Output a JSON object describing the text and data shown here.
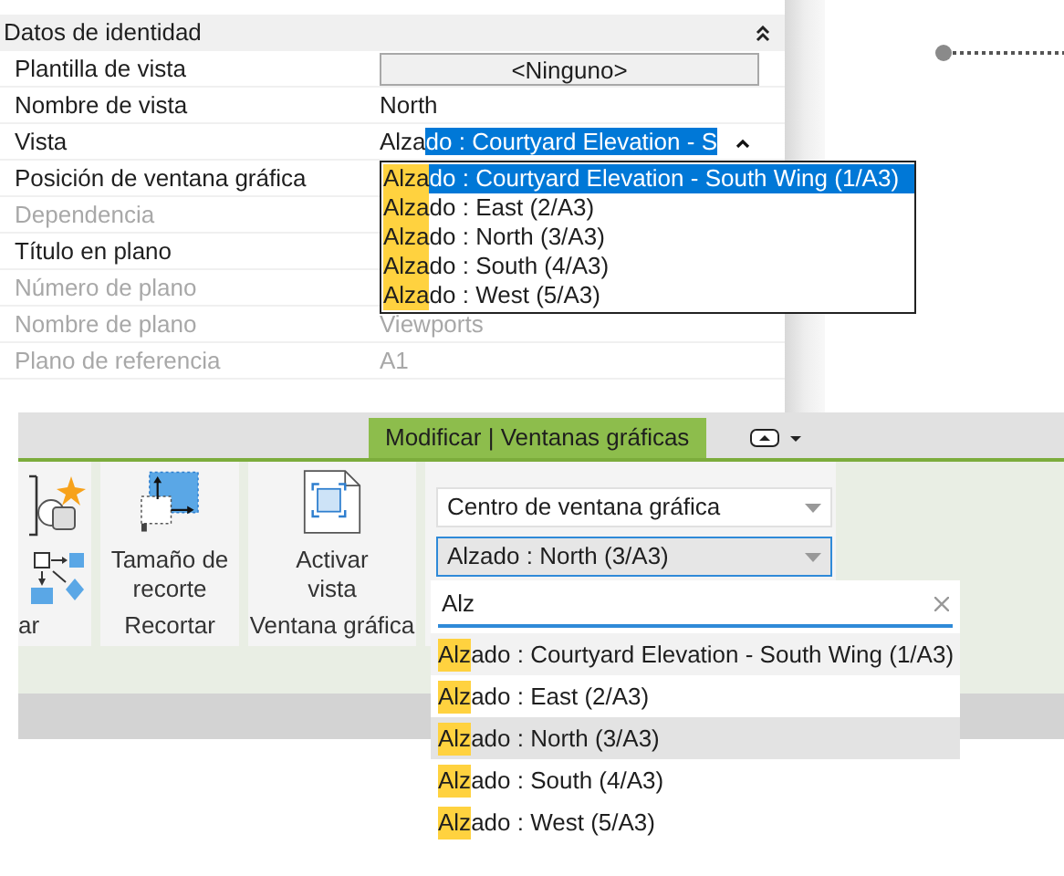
{
  "properties": {
    "section": {
      "title": "Datos de identidad",
      "expanded": true
    },
    "rows": [
      {
        "label": "Plantilla de vista",
        "kind": "button",
        "value": "<Ninguno>",
        "disabled": false
      },
      {
        "label": "Nombre de vista",
        "kind": "text",
        "value": "North",
        "disabled": false
      },
      {
        "label": "Vista",
        "kind": "combo",
        "typed": "Alza",
        "selected_text": "do : Courtyard Elevation - S",
        "disabled": false
      },
      {
        "label": "Posición de ventana gráfica",
        "kind": "text",
        "disabled": false
      },
      {
        "label": "Dependencia",
        "kind": "text",
        "disabled": true
      },
      {
        "label": "Título en plano",
        "kind": "text",
        "disabled": false
      },
      {
        "label": "Número de plano",
        "kind": "text",
        "disabled": true
      },
      {
        "label": "Nombre de plano",
        "kind": "text",
        "value": "Viewports",
        "disabled": true
      },
      {
        "label": "Plano de referencia",
        "kind": "text",
        "value": "A1",
        "disabled": true
      }
    ],
    "dropdown": [
      {
        "match": "Alza",
        "rest": "do : Courtyard Elevation - South Wing (1/A3)",
        "selected": true
      },
      {
        "match": "Alza",
        "rest": "do : East (2/A3)",
        "selected": false
      },
      {
        "match": "Alza",
        "rest": "do : North (3/A3)",
        "selected": false
      },
      {
        "match": "Alza",
        "rest": "do : South (4/A3)",
        "selected": false
      },
      {
        "match": "Alza",
        "rest": "do : West (5/A3)",
        "selected": false
      }
    ]
  },
  "ribbon": {
    "tabs": [
      {
        "label": "Modificar | Ventanas gráficas",
        "selected": true
      }
    ],
    "panels": [
      {
        "kind": "cut",
        "footer": "ar"
      },
      {
        "kind": "crop",
        "label": "Tamaño de recorte",
        "footer": "Recortar"
      },
      {
        "kind": "activate",
        "label": "Activar vista",
        "footer": "Ventana gráfica"
      },
      {
        "kind": "combos",
        "combos": [
          {
            "value": "Centro de ventana gráfica",
            "focused": false
          },
          {
            "value": "Alzado : North (3/A3)",
            "focused": true
          }
        ]
      }
    ],
    "search": {
      "value": "Alz"
    },
    "results": [
      {
        "match": "Alz",
        "rest": "ado : Courtyard Elevation - South Wing (1/A3)",
        "hovered": true,
        "selected": false
      },
      {
        "match": "Alz",
        "rest": "ado : East (2/A3)",
        "hovered": false,
        "selected": false
      },
      {
        "match": "Alz",
        "rest": "ado : North (3/A3)",
        "hovered": false,
        "selected": true
      },
      {
        "match": "Alz",
        "rest": "ado : South (4/A3)",
        "hovered": false,
        "selected": false
      },
      {
        "match": "Alz",
        "rest": "ado : West (5/A3)",
        "hovered": false,
        "selected": false
      }
    ]
  }
}
